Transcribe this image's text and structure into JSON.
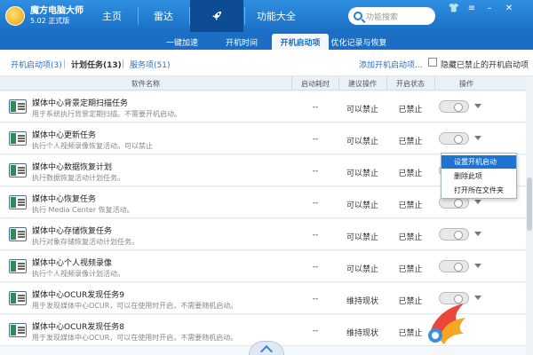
{
  "app": {
    "name": "魔方电脑大师",
    "version": "5.02 正式版"
  },
  "nav": {
    "tabs": [
      {
        "label": "主页"
      },
      {
        "label": "雷达"
      },
      {
        "label": "功能大全"
      }
    ],
    "active_icon": "rocket-icon"
  },
  "search": {
    "placeholder": "功能搜索"
  },
  "subnav": {
    "tabs": [
      {
        "label": "一键加速"
      },
      {
        "label": "开机时间"
      },
      {
        "label": "开机启动项"
      },
      {
        "label": "优化记录与恢复"
      }
    ],
    "active_index": 2
  },
  "filters": {
    "tabs": [
      {
        "label": "开机启动项(3)"
      },
      {
        "label": "计划任务(13)"
      },
      {
        "label": "服务项(51)"
      }
    ],
    "active_index": 1,
    "add_link": "添加开机启动项...",
    "hide_disabled_label": "隐藏已禁止的开机启动项",
    "hide_disabled_checked": false
  },
  "table": {
    "columns": [
      "软件名称",
      "启动耗时",
      "建议操作",
      "开启状态",
      "操作"
    ],
    "rows": [
      {
        "title": "媒体中心背景定期扫描任务",
        "desc": "用于系统执行背景定期扫描。不需要开机启动。",
        "duration": "--",
        "suggest": "可以禁止",
        "status": "已禁止"
      },
      {
        "title": "媒体中心更新任务",
        "desc": "执行个人视频录像恢复活动。可以禁止",
        "duration": "--",
        "suggest": "可以禁止",
        "status": "已禁止"
      },
      {
        "title": "媒体中心数据恢复计划",
        "desc": "执行数据恢复活动计划任务。",
        "duration": "--",
        "suggest": "可以禁止",
        "status": "已禁止"
      },
      {
        "title": "媒体中心恢复任务",
        "desc": "执行 Media Center 恢复活动。",
        "duration": "--",
        "suggest": "可以禁止",
        "status": "已禁止"
      },
      {
        "title": "媒体中心存储恢复任务",
        "desc": "执行对象存储恢复活动计划任务。",
        "duration": "--",
        "suggest": "可以禁止",
        "status": "已禁止"
      },
      {
        "title": "媒体中心个人视频录像",
        "desc": "执行个人视频录像计划活动。",
        "duration": "--",
        "suggest": "可以禁止",
        "status": "已禁止"
      },
      {
        "title": "媒体中心OCUR发现任务9",
        "desc": "用于发现媒体中心OCUR，可以在使用时开启，不需要随机启动。",
        "duration": "--",
        "suggest": "维持现状",
        "status": "已禁止"
      },
      {
        "title": "媒体中心OCUR发现任务8",
        "desc": "用于发现媒体中心OCUR，可以在使用时开启，不需要随机启动。",
        "duration": "--",
        "suggest": "维持现状",
        "status": "已禁止"
      }
    ]
  },
  "context_menu": {
    "items": [
      {
        "label": "设置开机启动"
      },
      {
        "label": "删除此项"
      },
      {
        "label": "打开所在文件夹"
      }
    ],
    "highlighted_index": 0
  },
  "colors": {
    "topbar": "#1a6fc4",
    "accent": "#1e74d0"
  }
}
